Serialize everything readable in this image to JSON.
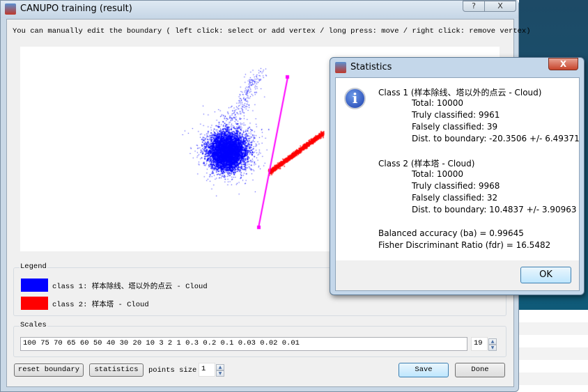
{
  "main_window": {
    "title": "CANUPO training (result)",
    "help_label": "?",
    "close_label": "X",
    "instructions": "You can manually edit the boundary ( left click: select or add vertex / long press: move / right click: remove vertex)",
    "plot": {
      "class1_color": "#0000ff",
      "class2_color": "#ff0000",
      "boundary_color": "#ff00ff"
    },
    "legend": {
      "title": "Legend",
      "items": [
        {
          "label": "class 1: 样本除线、塔以外的点云 - Cloud",
          "color": "#0000ff"
        },
        {
          "label": "class 2: 样本塔 - Cloud",
          "color": "#ff0000"
        }
      ]
    },
    "scales": {
      "title": "Scales",
      "value": "100 75 70 65 60 50 40 30 20 10 3 2 1 0.3 0.2 0.1 0.03 0.02 0.01",
      "count": "19"
    },
    "buttons": {
      "reset": "reset boundary",
      "statistics": "statistics",
      "points_size_label": "points size",
      "points_size": "1",
      "save": "Save",
      "done": "Done"
    }
  },
  "statistics_dialog": {
    "title": "Statistics",
    "close_label": "X",
    "class1": {
      "heading": "Class 1 (样本除线、塔以外的点云 - Cloud)",
      "total": "Total: 10000",
      "truly": "Truly classified: 9961",
      "falsely": "Falsely classified: 39",
      "dist": "Dist. to boundary: -20.3506 +/- 6.49371"
    },
    "class2": {
      "heading": "Class 2 (样本塔 - Cloud)",
      "total": "Total: 10000",
      "truly": "Truly classified: 9968",
      "falsely": "Falsely classified: 32",
      "dist": "Dist. to boundary: 10.4837 +/- 3.90963"
    },
    "balanced_accuracy": "Balanced accuracy (ba) = 0.99645",
    "fdr": "Fisher Discriminant Ratio (fdr) = 16.5482",
    "ok": "OK"
  }
}
